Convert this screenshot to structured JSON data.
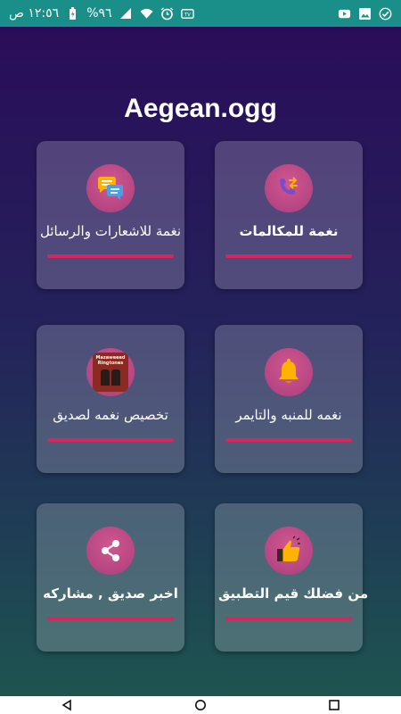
{
  "status_bar": {
    "time": "١٢:٥٦ ص",
    "battery": "%٩٦",
    "icons": [
      "battery-icon",
      "signal-icon",
      "wifi-icon",
      "alarm-icon",
      "tv-icon",
      "youtube-icon",
      "picture-icon",
      "check-icon"
    ]
  },
  "app": {
    "title": "Aegean.ogg",
    "cards": [
      {
        "label": "نغمة للمكالمات",
        "icon": "call-swap-icon"
      },
      {
        "label": "نغمة للاشعارات والرسائل",
        "icon": "chat-bubbles-icon"
      },
      {
        "label": "نغمه للمنبه والتايمر",
        "icon": "bell-icon"
      },
      {
        "label": "تخصيص نغمه لصديق",
        "icon": "poster-image"
      },
      {
        "label": "من فضلك قيم التطبيق",
        "icon": "thumbs-up-icon"
      },
      {
        "label": "اخبر صديق , مشاركه",
        "icon": "share-icon"
      }
    ],
    "poster_text": "Mazaweeed Ringtones"
  },
  "colors": {
    "status_bar": "#1a8f8a",
    "accent_bar": "#d4275f",
    "icon_circle": "#c04f86"
  },
  "nav": {
    "buttons": [
      "back-icon",
      "home-icon",
      "recents-icon"
    ]
  }
}
